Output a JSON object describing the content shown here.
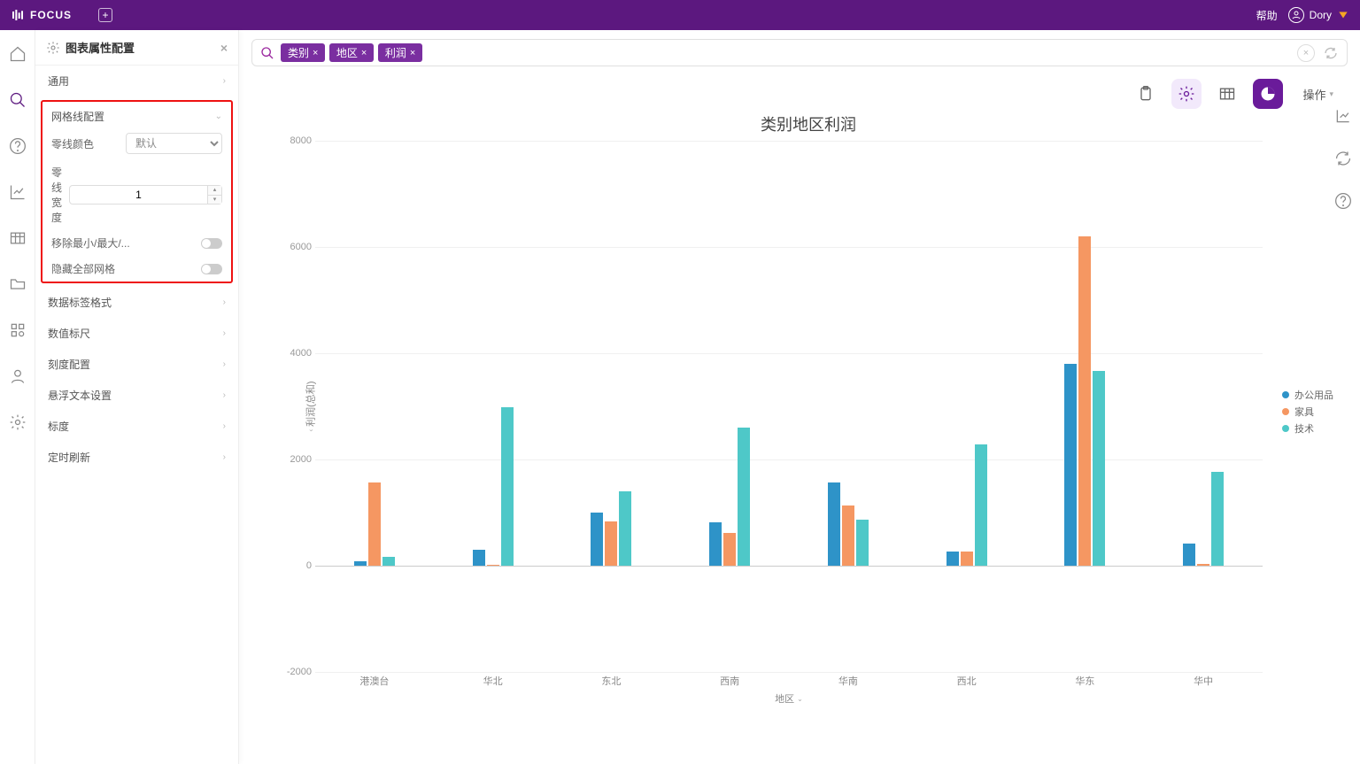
{
  "topbar": {
    "brand": "FOCUS",
    "help": "帮助",
    "username": "Dory"
  },
  "rail": {
    "items": [
      "home",
      "search",
      "help",
      "chart",
      "table",
      "folder",
      "apps",
      "user",
      "settings"
    ]
  },
  "sidebar": {
    "title": "图表属性配置",
    "sections": {
      "general": "通用",
      "gridline": "网格线配置",
      "datalabel": "数据标签格式",
      "valuescale": "数值标尺",
      "tick": "刻度配置",
      "hover": "悬浮文本设置",
      "dimension": "标度",
      "refresh": "定时刷新"
    },
    "gridline_props": {
      "zero_color_label": "零线颜色",
      "zero_color_value": "默认",
      "zero_width_label": "零线宽度",
      "zero_width_value": "1",
      "remove_minmax_label": "移除最小/最大/...",
      "hide_all_label": "隐藏全部网格"
    }
  },
  "search": {
    "tags": [
      "类别",
      "地区",
      "利润"
    ]
  },
  "toolbar": {
    "operate": "操作"
  },
  "chart_data": {
    "type": "bar",
    "title": "类别地区利润",
    "xlabel": "地区",
    "ylabel": "利润(总和)",
    "ylim": [
      -2000,
      8000
    ],
    "yticks": [
      -2000,
      0,
      2000,
      4000,
      6000,
      8000
    ],
    "categories": [
      "港澳台",
      "华北",
      "东北",
      "西南",
      "华南",
      "西北",
      "华东",
      "华中"
    ],
    "series": [
      {
        "name": "办公用品",
        "color": "#2e93c8",
        "values": [
          80,
          300,
          1000,
          820,
          1570,
          260,
          3800,
          420
        ]
      },
      {
        "name": "家具",
        "color": "#f59762",
        "values": [
          1560,
          20,
          830,
          620,
          1130,
          260,
          6200,
          40
        ]
      },
      {
        "name": "技术",
        "color": "#4ec8c8",
        "values": [
          170,
          2980,
          1400,
          2600,
          870,
          2280,
          3670,
          1760
        ]
      }
    ]
  }
}
